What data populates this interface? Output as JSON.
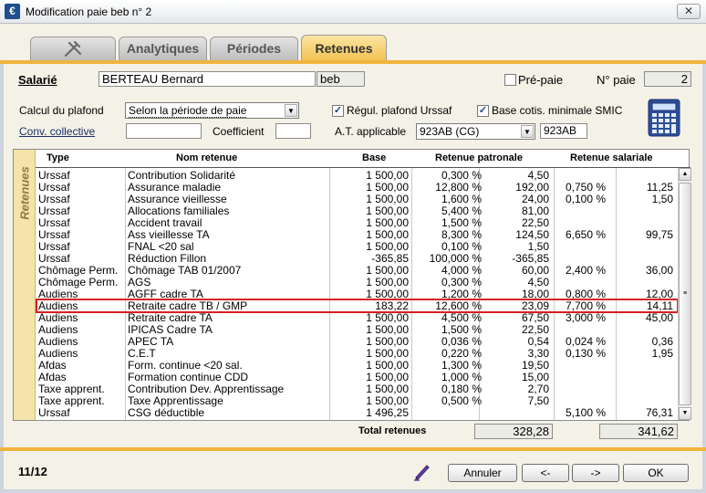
{
  "window": {
    "title": "Modification paie beb n° 2",
    "app_icon": "€"
  },
  "tabs": [
    {
      "label": "",
      "icon": "tool-icon"
    },
    {
      "label": "Analytiques"
    },
    {
      "label": "Périodes"
    },
    {
      "label": "Retenues",
      "active": true
    }
  ],
  "header": {
    "salarie_label": "Salarié",
    "salarie_name": "BERTEAU Bernard",
    "salarie_code": "beb",
    "prepaie_label": "Pré-paie",
    "prepaie_checked": false,
    "no_paie_label": "N° paie",
    "no_paie_value": "2"
  },
  "form": {
    "calcul_label": "Calcul du plafond",
    "calcul_value": "Selon la période de paie",
    "regul_label": "Régul. plafond Urssaf",
    "regul_checked": true,
    "base_smic_label": "Base cotis. minimale SMIC",
    "base_smic_checked": true,
    "conv_label": "Conv. collective",
    "conv_value": "",
    "coef_label": "Coefficient",
    "coef_value": "",
    "at_label": "A.T. applicable",
    "at_value": "923AB (CG)",
    "at_code": "923AB"
  },
  "grid": {
    "side_label": "Retenues",
    "headers": {
      "type": "Type",
      "nom": "Nom retenue",
      "base": "Base",
      "patronale": "Retenue patronale",
      "salariale": "Retenue salariale"
    },
    "selected_index": 11,
    "rows": [
      {
        "type": "Urssaf",
        "nom": "Contribution Solidarité",
        "base": "1 500,00",
        "taux_pat": "0,300 %",
        "mont_pat": "4,50",
        "taux_sal": "",
        "mont_sal": ""
      },
      {
        "type": "Urssaf",
        "nom": "Assurance maladie",
        "base": "1 500,00",
        "taux_pat": "12,800 %",
        "mont_pat": "192,00",
        "taux_sal": "0,750 %",
        "mont_sal": "11,25"
      },
      {
        "type": "Urssaf",
        "nom": "Assurance vieillesse",
        "base": "1 500,00",
        "taux_pat": "1,600 %",
        "mont_pat": "24,00",
        "taux_sal": "0,100 %",
        "mont_sal": "1,50"
      },
      {
        "type": "Urssaf",
        "nom": "Allocations familiales",
        "base": "1 500,00",
        "taux_pat": "5,400 %",
        "mont_pat": "81,00",
        "taux_sal": "",
        "mont_sal": ""
      },
      {
        "type": "Urssaf",
        "nom": "Accident travail",
        "base": "1 500,00",
        "taux_pat": "1,500 %",
        "mont_pat": "22,50",
        "taux_sal": "",
        "mont_sal": ""
      },
      {
        "type": "Urssaf",
        "nom": "Ass vieillesse TA",
        "base": "1 500,00",
        "taux_pat": "8,300 %",
        "mont_pat": "124,50",
        "taux_sal": "6,650 %",
        "mont_sal": "99,75"
      },
      {
        "type": "Urssaf",
        "nom": "FNAL <20 sal",
        "base": "1 500,00",
        "taux_pat": "0,100 %",
        "mont_pat": "1,50",
        "taux_sal": "",
        "mont_sal": ""
      },
      {
        "type": "Urssaf",
        "nom": "Réduction Fillon",
        "base": "-365,85",
        "taux_pat": "100,000 %",
        "mont_pat": "-365,85",
        "taux_sal": "",
        "mont_sal": ""
      },
      {
        "type": "Chômage Perm.",
        "nom": "Chômage TAB 01/2007",
        "base": "1 500,00",
        "taux_pat": "4,000 %",
        "mont_pat": "60,00",
        "taux_sal": "2,400 %",
        "mont_sal": "36,00"
      },
      {
        "type": "Chômage Perm.",
        "nom": "AGS",
        "base": "1 500,00",
        "taux_pat": "0,300 %",
        "mont_pat": "4,50",
        "taux_sal": "",
        "mont_sal": ""
      },
      {
        "type": "Audiens",
        "nom": "AGFF cadre TA",
        "base": "1 500,00",
        "taux_pat": "1,200 %",
        "mont_pat": "18,00",
        "taux_sal": "0,800 %",
        "mont_sal": "12,00"
      },
      {
        "type": "Audiens",
        "nom": "Retraite cadre TB / GMP",
        "base": "183,22",
        "taux_pat": "12,600 %",
        "mont_pat": "23,09",
        "taux_sal": "7,700 %",
        "mont_sal": "14,11"
      },
      {
        "type": "Audiens",
        "nom": "Retraite cadre TA",
        "base": "1 500,00",
        "taux_pat": "4,500 %",
        "mont_pat": "67,50",
        "taux_sal": "3,000 %",
        "mont_sal": "45,00"
      },
      {
        "type": "Audiens",
        "nom": "IPICAS Cadre TA",
        "base": "1 500,00",
        "taux_pat": "1,500 %",
        "mont_pat": "22,50",
        "taux_sal": "",
        "mont_sal": ""
      },
      {
        "type": "Audiens",
        "nom": "APEC TA",
        "base": "1 500,00",
        "taux_pat": "0,036 %",
        "mont_pat": "0,54",
        "taux_sal": "0,024 %",
        "mont_sal": "0,36"
      },
      {
        "type": "Audiens",
        "nom": "C.E.T",
        "base": "1 500,00",
        "taux_pat": "0,220 %",
        "mont_pat": "3,30",
        "taux_sal": "0,130 %",
        "mont_sal": "1,95"
      },
      {
        "type": "Afdas",
        "nom": "Form. continue <20 sal.",
        "base": "1 500,00",
        "taux_pat": "1,300 %",
        "mont_pat": "19,50",
        "taux_sal": "",
        "mont_sal": ""
      },
      {
        "type": "Afdas",
        "nom": "Formation continue CDD",
        "base": "1 500,00",
        "taux_pat": "1,000 %",
        "mont_pat": "15,00",
        "taux_sal": "",
        "mont_sal": ""
      },
      {
        "type": "Taxe apprent.",
        "nom": "Contribution Dev. Apprentissage",
        "base": "1 500,00",
        "taux_pat": "0,180 %",
        "mont_pat": "2,70",
        "taux_sal": "",
        "mont_sal": ""
      },
      {
        "type": "Taxe apprent.",
        "nom": "Taxe Apprentissage",
        "base": "1 500,00",
        "taux_pat": "0,500 %",
        "mont_pat": "7,50",
        "taux_sal": "",
        "mont_sal": ""
      },
      {
        "type": "Urssaf",
        "nom": "CSG déductible",
        "base": "1 496,25",
        "taux_pat": "",
        "mont_pat": "",
        "taux_sal": "5,100 %",
        "mont_sal": "76,31"
      }
    ],
    "total_label": "Total retenues",
    "total_patronale": "328,28",
    "total_salariale": "341,62"
  },
  "footer": {
    "page_indicator": "11/12",
    "annuler_label": "Annuler",
    "prev_label": "<-",
    "next_label": "->",
    "ok_label": "OK"
  },
  "colors": {
    "accent": "#f0b43c",
    "active_tab": "#f2bf4e",
    "selection": "#d62020",
    "side_band": "#f6e3a9"
  }
}
